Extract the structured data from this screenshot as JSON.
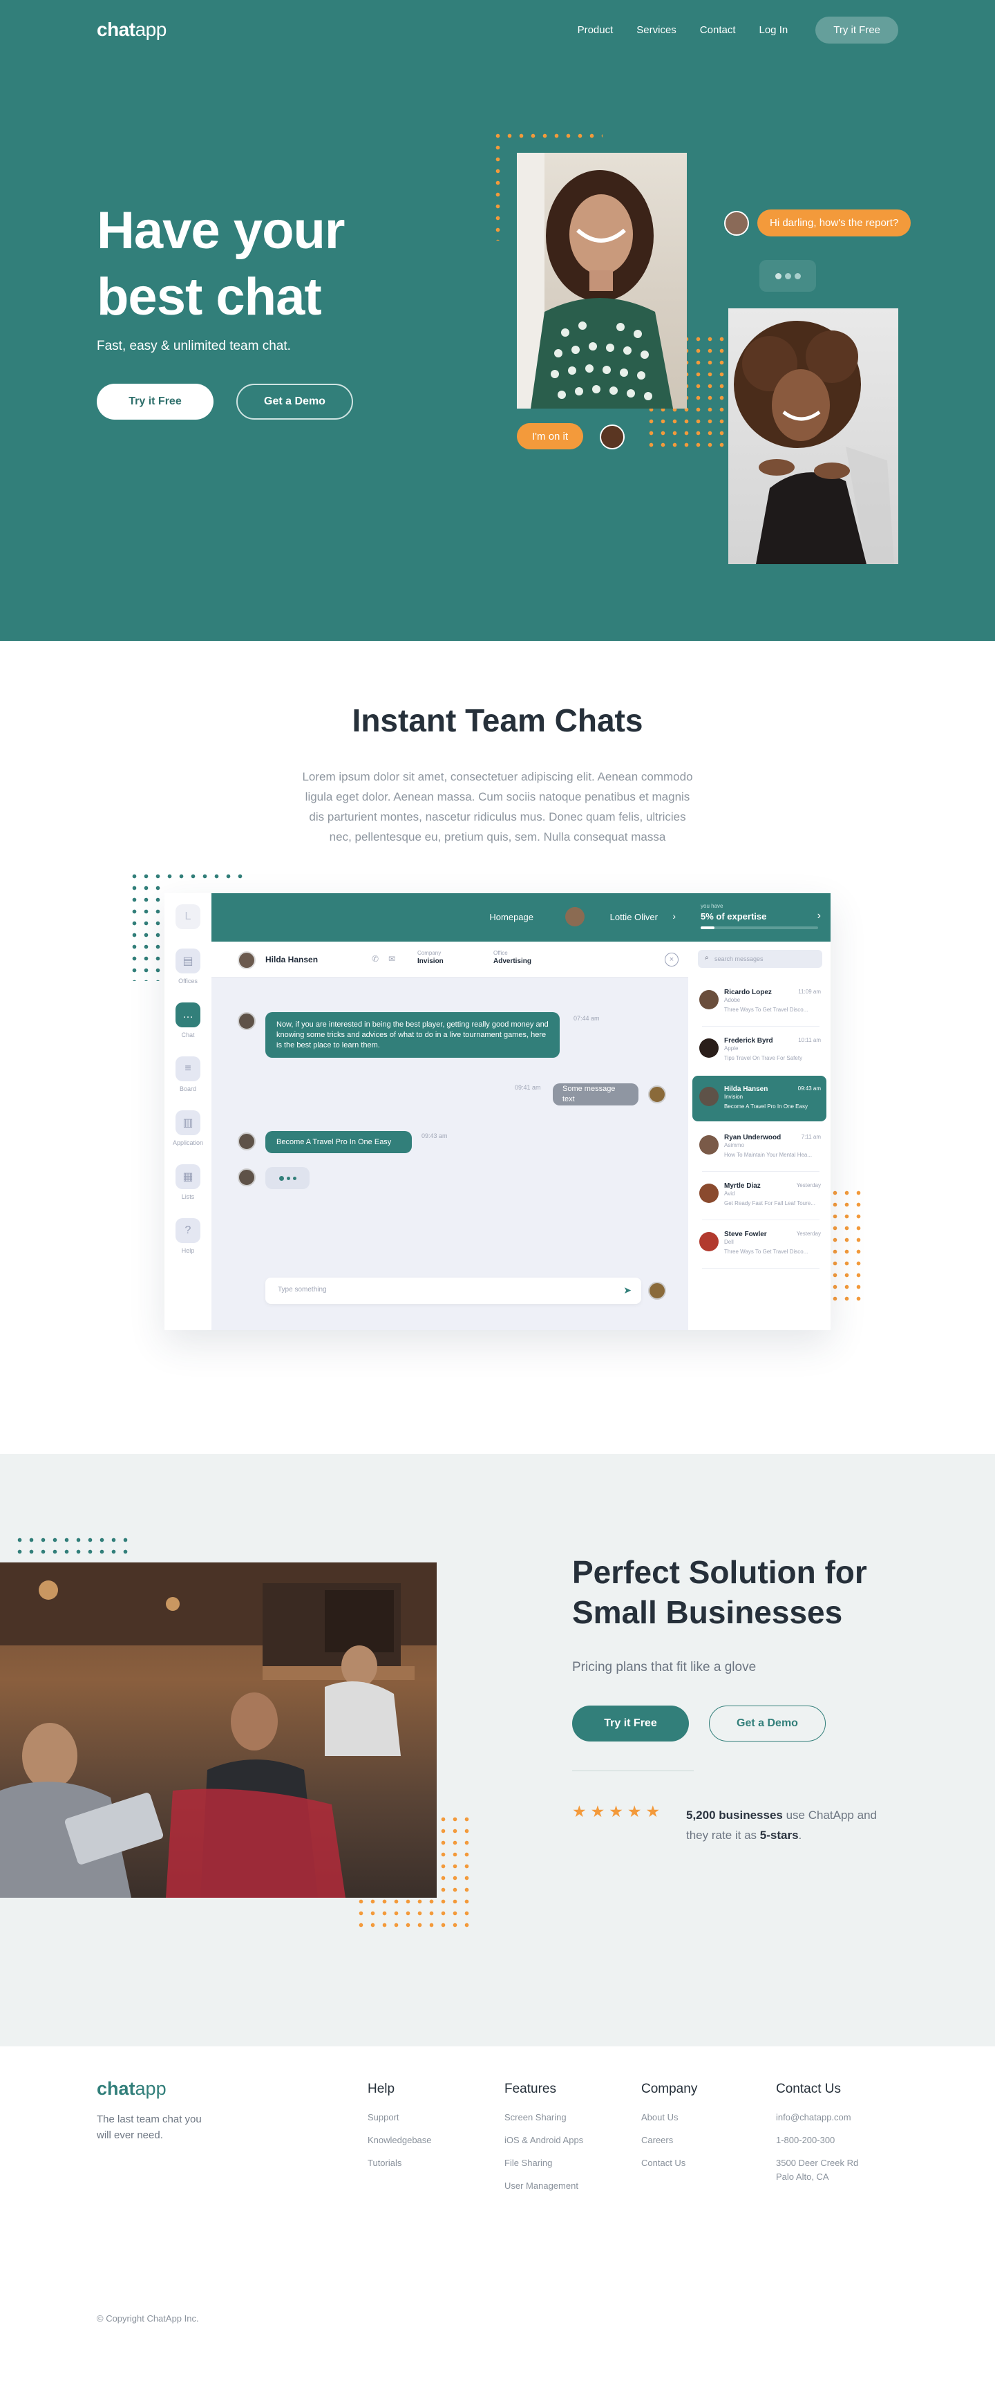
{
  "nav": {
    "logo_bold": "chat",
    "logo_light": "app",
    "links": [
      "Product",
      "Services",
      "Contact",
      "Log In"
    ],
    "cta": "Try it Free"
  },
  "hero": {
    "title": "Have your best chat",
    "subtitle": "Fast, easy & unlimited team chat.",
    "primary_button": "Try it Free",
    "secondary_button": "Get a Demo",
    "bubble_top": "Hi darling, how's the report?",
    "bubble_bottom": "I'm on it"
  },
  "team_chats": {
    "title": "Instant Team Chats",
    "paragraph": "Lorem ipsum dolor sit amet, consectetuer adipiscing elit. Aenean commodo ligula eget dolor. Aenean massa. Cum sociis natoque penatibus et magnis dis parturient montes, nascetur ridiculus mus. Donec quam felis, ultricies nec, pellentesque eu, pretium quis, sem. Nulla consequat massa"
  },
  "app": {
    "sidebar": [
      {
        "label": "Offices",
        "icon": "briefcase-icon"
      },
      {
        "label": "Chat",
        "icon": "chat-bubble-icon"
      },
      {
        "label": "Board",
        "icon": "list-icon"
      },
      {
        "label": "Application",
        "icon": "document-icon"
      },
      {
        "label": "Lists",
        "icon": "table-icon"
      },
      {
        "label": "Help",
        "icon": "help-icon"
      }
    ],
    "sidebar_top_letter": "L",
    "topbar": {
      "home": "Homepage",
      "user": "Lottie Oliver"
    },
    "expertise": {
      "small": "you have",
      "big": "5% of expertise",
      "progress": 0.05
    },
    "conversation": {
      "name": "Hilda Hansen",
      "company_label": "Company",
      "company_value": "Invision",
      "office_label": "Office",
      "office_value": "Advertising"
    },
    "messages": {
      "m1": "Now, if you are interested in being the best player, getting really good money and knowing some tricks and advices of what to do in a live tournament games, here is the best place to learn them.",
      "m1_time": "07:44 am",
      "m2": "Some message text",
      "m2_time": "09:41 am",
      "m3": "Become A Travel Pro In One Easy",
      "m3_time": "09:43 am"
    },
    "input_placeholder": "Type something",
    "search_placeholder": "search messages",
    "contacts": [
      {
        "name": "Ricardo Lopez",
        "company": "Adobe",
        "text": "Three Ways To Get Travel Disco...",
        "time": "11:09 am"
      },
      {
        "name": "Frederick Byrd",
        "company": "Apple",
        "text": "Tips Travel On Trave For Safety",
        "time": "10:11 am"
      },
      {
        "name": "Hilda Hansen",
        "company": "Invision",
        "text": "Become A Travel Pro In One Easy",
        "time": "09:43 am"
      },
      {
        "name": "Ryan Underwood",
        "company": "Asimmo",
        "text": "How To Maintain Your Mental Hea...",
        "time": "7:11 am"
      },
      {
        "name": "Myrtle Diaz",
        "company": "Avid",
        "text": "Get Ready Fast For Fall Leaf Toure...",
        "time": "Yesterday"
      },
      {
        "name": "Steve Fowler",
        "company": "Dell",
        "text": "Three Ways To Get Travel Disco...",
        "time": "Yesterday"
      }
    ]
  },
  "solution": {
    "title": "Perfect Solution for Small Businesses",
    "subtitle": "Pricing plans that fit like a glove",
    "primary_button": "Try it Free",
    "secondary_button": "Get a Demo",
    "stars": 5,
    "stars_text": "★★★★★",
    "rating_bold": "5,200 businesses",
    "rating_mid": " use ChatApp and they rate it as ",
    "rating_bold2": "5-stars",
    "rating_end": "."
  },
  "footer": {
    "logo_bold": "chat",
    "logo_light": "app",
    "tagline": "The last team chat you will ever need.",
    "columns": [
      {
        "title": "Help",
        "links": [
          "Support",
          "Knowledgebase",
          "Tutorials"
        ]
      },
      {
        "title": "Features",
        "links": [
          "Screen Sharing",
          "iOS & Android Apps",
          "File Sharing",
          "User Management"
        ]
      },
      {
        "title": "Company",
        "links": [
          "About Us",
          "Careers",
          "Contact Us"
        ]
      },
      {
        "title": "Contact Us",
        "links": [
          "info@chatapp.com",
          "1-800-200-300",
          "3500 Deer Creek Rd Palo Alto, CA"
        ]
      }
    ],
    "copyright": "© Copyright ChatApp Inc."
  },
  "colors": {
    "teal": "#327f7a",
    "orange": "#f39a3b",
    "light_bg": "#eef2f2"
  }
}
